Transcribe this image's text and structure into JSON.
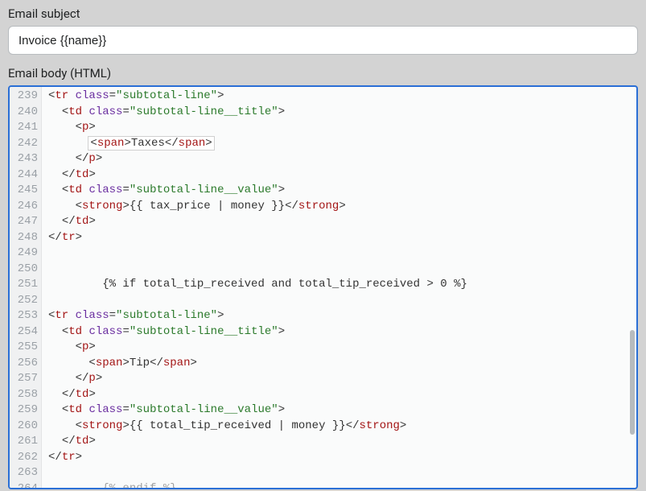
{
  "subject": {
    "label": "Email subject",
    "value": "Invoice {{name}}"
  },
  "body": {
    "label": "Email body (HTML)"
  },
  "editor": {
    "first_line_no": 239,
    "visible_lines": 26,
    "lines": [
      {
        "indent": 0,
        "kind": "open",
        "tag": "tr",
        "attr": "class",
        "val": "subtotal-line"
      },
      {
        "indent": 1,
        "kind": "open",
        "tag": "td",
        "attr": "class",
        "val": "subtotal-line__title"
      },
      {
        "indent": 2,
        "kind": "open",
        "tag": "p"
      },
      {
        "indent": 3,
        "kind": "span-text",
        "text": "Taxes",
        "highlight": true
      },
      {
        "indent": 2,
        "kind": "close",
        "tag": "p"
      },
      {
        "indent": 1,
        "kind": "close",
        "tag": "td"
      },
      {
        "indent": 1,
        "kind": "open",
        "tag": "td",
        "attr": "class",
        "val": "subtotal-line__value"
      },
      {
        "indent": 2,
        "kind": "strong-text",
        "text": "{{ tax_price | money }}"
      },
      {
        "indent": 1,
        "kind": "close",
        "tag": "td"
      },
      {
        "indent": 0,
        "kind": "close",
        "tag": "tr"
      },
      {
        "indent": 0,
        "kind": "blank"
      },
      {
        "indent": 0,
        "kind": "blank"
      },
      {
        "indent": 4,
        "kind": "raw",
        "text": "{% if total_tip_received and total_tip_received > 0 %}"
      },
      {
        "indent": 0,
        "kind": "blank"
      },
      {
        "indent": 0,
        "kind": "open",
        "tag": "tr",
        "attr": "class",
        "val": "subtotal-line"
      },
      {
        "indent": 1,
        "kind": "open",
        "tag": "td",
        "attr": "class",
        "val": "subtotal-line__title"
      },
      {
        "indent": 2,
        "kind": "open",
        "tag": "p"
      },
      {
        "indent": 3,
        "kind": "span-text",
        "text": "Tip"
      },
      {
        "indent": 2,
        "kind": "close",
        "tag": "p"
      },
      {
        "indent": 1,
        "kind": "close",
        "tag": "td"
      },
      {
        "indent": 1,
        "kind": "open",
        "tag": "td",
        "attr": "class",
        "val": "subtotal-line__value"
      },
      {
        "indent": 2,
        "kind": "strong-text",
        "text": "{{ total_tip_received | money }}"
      },
      {
        "indent": 1,
        "kind": "close",
        "tag": "td"
      },
      {
        "indent": 0,
        "kind": "close",
        "tag": "tr"
      },
      {
        "indent": 0,
        "kind": "blank"
      },
      {
        "indent": 4,
        "kind": "raw-cut",
        "text": "{% endif %}"
      }
    ]
  }
}
